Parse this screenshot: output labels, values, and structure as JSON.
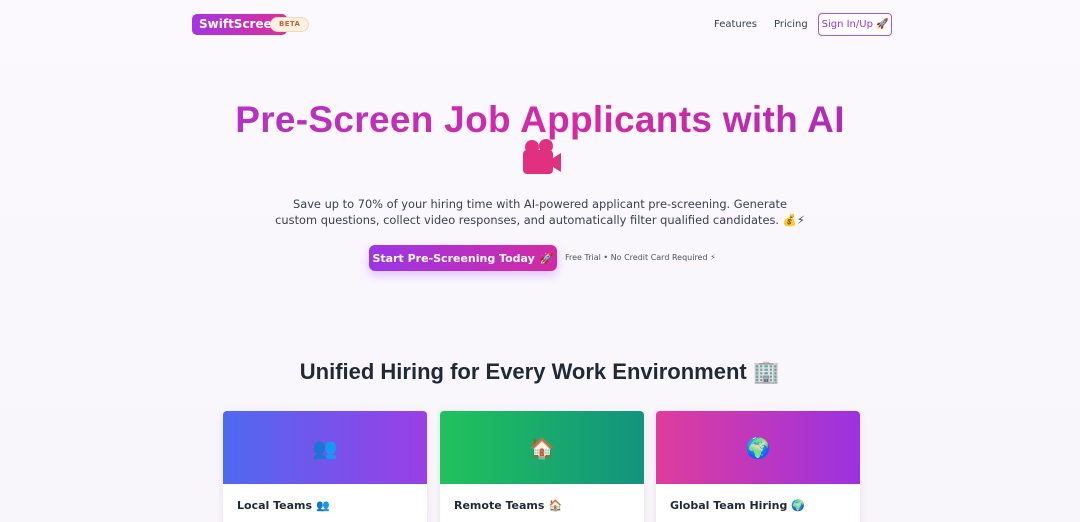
{
  "nav": {
    "logo": "SwiftScreen",
    "badge": "BETA",
    "links": [
      "Features",
      "Pricing"
    ],
    "signin_label": "Sign In/Up"
  },
  "hero": {
    "title": "Pre-Screen Job Applicants with AI",
    "title_icon": "video-camera-icon",
    "subtitle_line1": "Save up to 70% of your hiring time with AI-powered applicant pre-screening. Generate",
    "subtitle_line2": "custom questions, collect video responses, and automatically filter qualified candidates. 💰⚡",
    "cta_label": "Start Pre-Screening Today",
    "trial_note": "Free Trial • No Credit Card Required ⚡"
  },
  "section": {
    "title": "Unified Hiring for Every Work Environment 🏢",
    "cards": [
      {
        "label": "Local Teams",
        "icon": "people-icon",
        "emoji": "👥"
      },
      {
        "label": "Remote Teams",
        "icon": "house-icon",
        "emoji": "🏠"
      },
      {
        "label": "Global Team Hiring",
        "icon": "globe-icon",
        "emoji": "🌍"
      }
    ]
  },
  "colors": {
    "brand_purple": "#9b36e6",
    "brand_pink": "#d32aa3",
    "card_blue": "#4f69f0",
    "card_green": "#21c25c",
    "card_magenta": "#df3d9c"
  }
}
